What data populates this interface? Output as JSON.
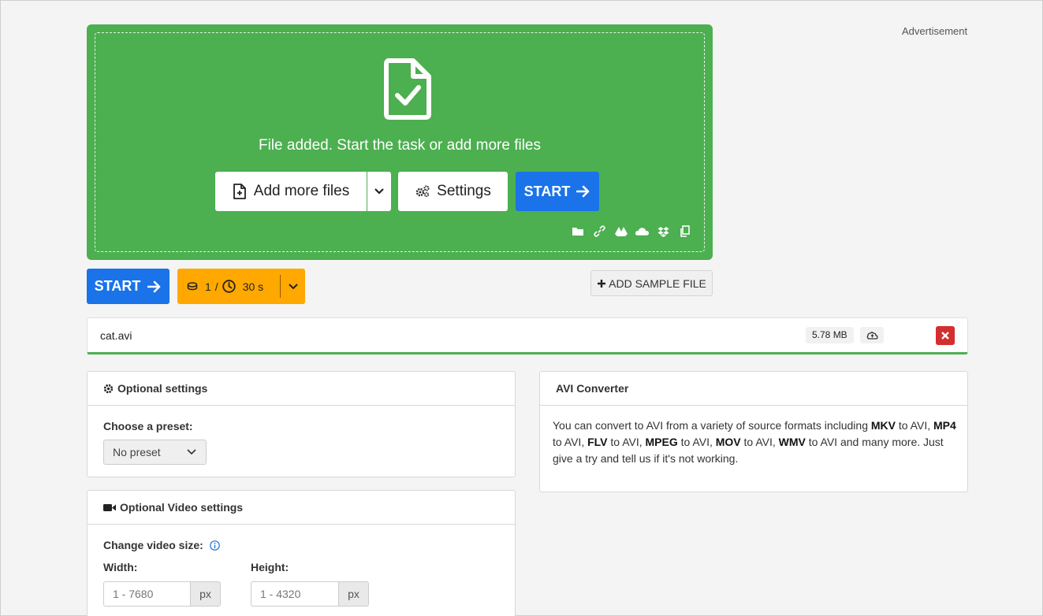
{
  "ad": {
    "label": "Advertisement"
  },
  "upload": {
    "message": "File added. Start the task or add more files",
    "add_more_label": "Add more files",
    "settings_label": "Settings",
    "start_label": "START",
    "sources": [
      "folder-icon",
      "link-icon",
      "google-drive-icon",
      "onedrive-icon",
      "dropbox-icon",
      "clipboard-icon"
    ]
  },
  "toolbar": {
    "start_label": "START",
    "credits_count": "1",
    "credits_sep": "/",
    "credits_time": "30 s",
    "sample_label": "ADD SAMPLE FILE"
  },
  "file": {
    "name": "cat.avi",
    "size": "5.78 MB"
  },
  "optional_settings": {
    "title": "Optional settings",
    "preset_label": "Choose a preset:",
    "preset_value": "No preset"
  },
  "video_settings": {
    "title": "Optional Video settings",
    "size_label": "Change video size:",
    "width_label": "Width:",
    "width_placeholder": "1 - 7680",
    "height_label": "Height:",
    "height_placeholder": "1 - 4320",
    "unit": "px"
  },
  "avi": {
    "title": "AVI Converter",
    "intro": "You can convert to AVI from a variety of source formats including ",
    "f1": "MKV",
    "t1": " to AVI, ",
    "f2": "MP4",
    "t2": " to AVI, ",
    "f3": "FLV",
    "t3": " to AVI, ",
    "f4": "MPEG",
    "t4": " to AVI, ",
    "f5": "MOV",
    "t5": " to AVI, ",
    "f6": "WMV",
    "t6": " to AVI and many more. Just give a try and tell us if it's not working."
  },
  "colors": {
    "green": "#4caf50",
    "blue": "#1a73e8",
    "orange": "#ffa800",
    "red": "#d32f2f"
  }
}
